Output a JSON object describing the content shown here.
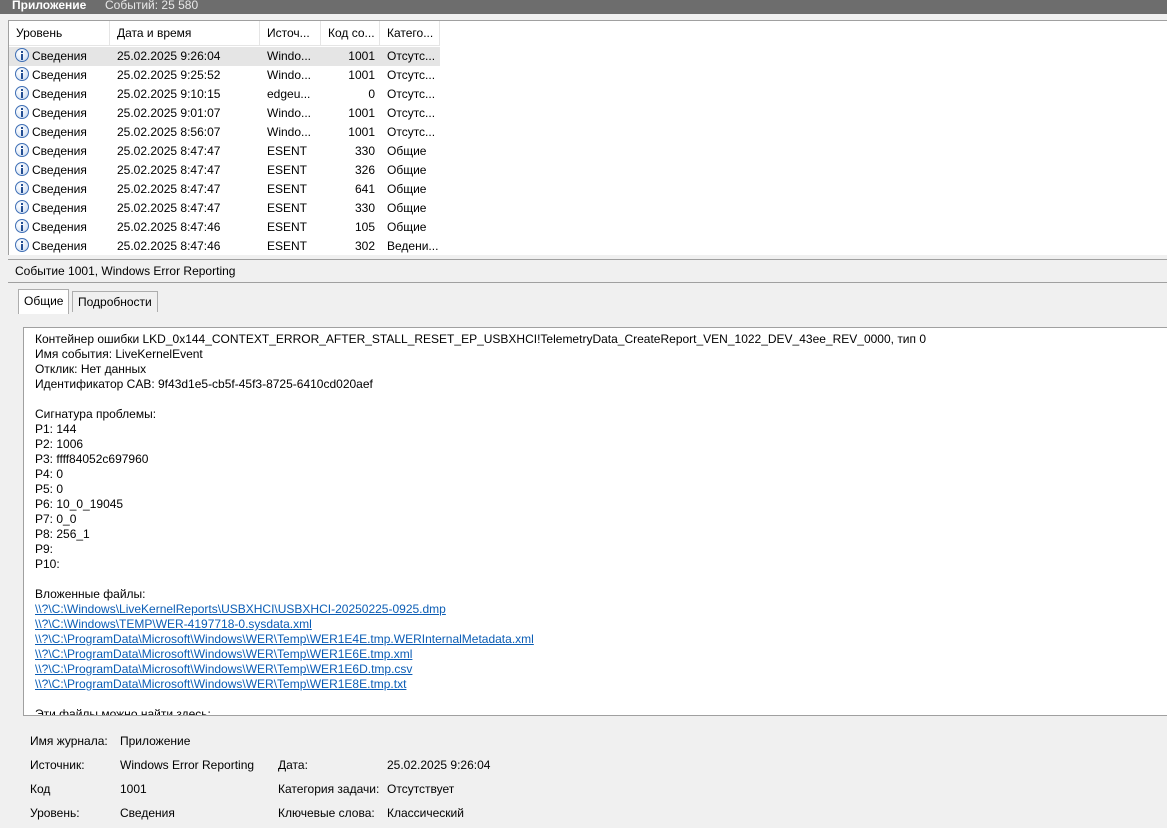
{
  "titlebar": {
    "log_name": "Приложение",
    "events_count": "Событий: 25 580"
  },
  "grid": {
    "columns": [
      "Уровень",
      "Дата и время",
      "Источ...",
      "Код со...",
      "Катего..."
    ],
    "rows": [
      {
        "level": "Сведения",
        "datetime": "25.02.2025 9:26:04",
        "source": "Windo...",
        "code": "1001",
        "category": "Отсутс..."
      },
      {
        "level": "Сведения",
        "datetime": "25.02.2025 9:25:52",
        "source": "Windo...",
        "code": "1001",
        "category": "Отсутс..."
      },
      {
        "level": "Сведения",
        "datetime": "25.02.2025 9:10:15",
        "source": "edgeu...",
        "code": "0",
        "category": "Отсутс..."
      },
      {
        "level": "Сведения",
        "datetime": "25.02.2025 9:01:07",
        "source": "Windo...",
        "code": "1001",
        "category": "Отсутс..."
      },
      {
        "level": "Сведения",
        "datetime": "25.02.2025 8:56:07",
        "source": "Windo...",
        "code": "1001",
        "category": "Отсутс..."
      },
      {
        "level": "Сведения",
        "datetime": "25.02.2025 8:47:47",
        "source": "ESENT",
        "code": "330",
        "category": "Общие"
      },
      {
        "level": "Сведения",
        "datetime": "25.02.2025 8:47:47",
        "source": "ESENT",
        "code": "326",
        "category": "Общие"
      },
      {
        "level": "Сведения",
        "datetime": "25.02.2025 8:47:47",
        "source": "ESENT",
        "code": "641",
        "category": "Общие"
      },
      {
        "level": "Сведения",
        "datetime": "25.02.2025 8:47:47",
        "source": "ESENT",
        "code": "330",
        "category": "Общие"
      },
      {
        "level": "Сведения",
        "datetime": "25.02.2025 8:47:46",
        "source": "ESENT",
        "code": "105",
        "category": "Общие"
      },
      {
        "level": "Сведения",
        "datetime": "25.02.2025 8:47:46",
        "source": "ESENT",
        "code": "302",
        "category": "Ведени..."
      }
    ]
  },
  "detail": {
    "header": "Событие 1001, Windows Error Reporting",
    "tabs": [
      "Общие",
      "Подробности"
    ],
    "description_lines": [
      "Контейнер ошибки LKD_0x144_CONTEXT_ERROR_AFTER_STALL_RESET_EP_USBXHCI!TelemetryData_CreateReport_VEN_1022_DEV_43ee_REV_0000, тип 0",
      "Имя события: LiveKernelEvent",
      "Отклик: Нет данных",
      "Идентификатор CAB: 9f43d1e5-cb5f-45f3-8725-6410cd020aef",
      "",
      "Сигнатура проблемы:",
      "P1: 144",
      "P2: 1006",
      "P3: ffff84052c697960",
      "P4: 0",
      "P5: 0",
      "P6: 10_0_19045",
      "P7: 0_0",
      "P8: 256_1",
      "P9:",
      "P10:",
      "",
      "Вложенные файлы:"
    ],
    "attached_files": [
      "\\\\?\\C:\\Windows\\LiveKernelReports\\USBXHCI\\USBXHCI-20250225-0925.dmp",
      "\\\\?\\C:\\Windows\\TEMP\\WER-4197718-0.sysdata.xml",
      "\\\\?\\C:\\ProgramData\\Microsoft\\Windows\\WER\\Temp\\WER1E4E.tmp.WERInternalMetadata.xml",
      "\\\\?\\C:\\ProgramData\\Microsoft\\Windows\\WER\\Temp\\WER1E6E.tmp.xml",
      "\\\\?\\C:\\ProgramData\\Microsoft\\Windows\\WER\\Temp\\WER1E6D.tmp.csv",
      "\\\\?\\C:\\ProgramData\\Microsoft\\Windows\\WER\\Temp\\WER1E8E.tmp.txt"
    ],
    "trailing_line": "Эти файлы можно найти здесь:"
  },
  "properties": {
    "log_label": "Имя журнала:",
    "log_value": "Приложение",
    "source_label": "Источник:",
    "source_value": "Windows Error Reporting",
    "date_label": "Дата:",
    "date_value": "25.02.2025 9:26:04",
    "code_label": "Код",
    "code_value": "1001",
    "task_label": "Категория задачи:",
    "task_value": "Отсутствует",
    "level_label": "Уровень:",
    "level_value": "Сведения",
    "keywords_label": "Ключевые слова:",
    "keywords_value": "Классический"
  },
  "colors": {
    "link": "#0b5db5",
    "selected_row": "#e5e5e5",
    "titlebar": "#6d6d6d"
  },
  "icons": {
    "level_info": "info-icon"
  }
}
